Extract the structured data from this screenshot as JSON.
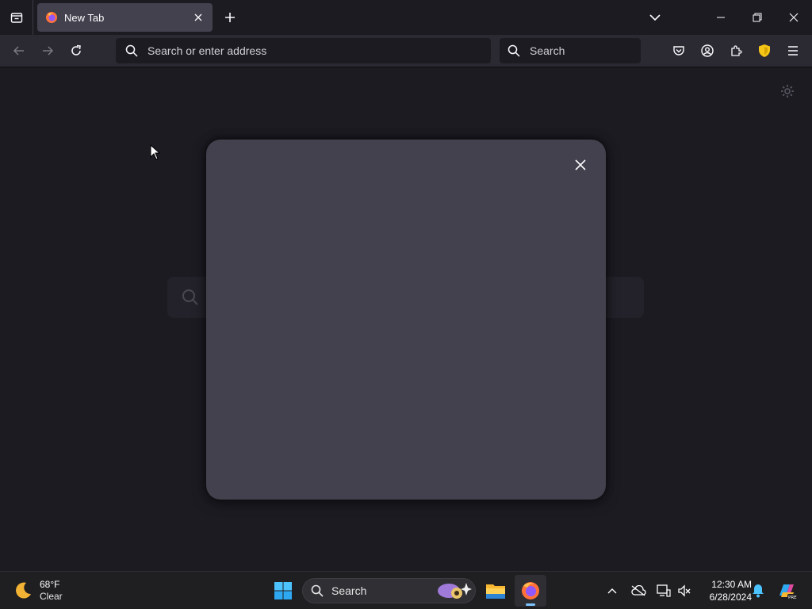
{
  "browser": {
    "tab": {
      "title": "New Tab"
    },
    "urlbar": {
      "placeholder": "Search or enter address"
    },
    "searchbar": {
      "placeholder": "Search"
    }
  },
  "taskbar": {
    "weather": {
      "temp": "68°F",
      "condition": "Clear"
    },
    "search": {
      "placeholder": "Search"
    },
    "clock": {
      "time": "12:30 AM",
      "date": "6/28/2024"
    }
  },
  "colors": {
    "accent": "#7dc5ff",
    "firefox_orange": "#ff7139",
    "shield_yellow": "#f5c518"
  }
}
